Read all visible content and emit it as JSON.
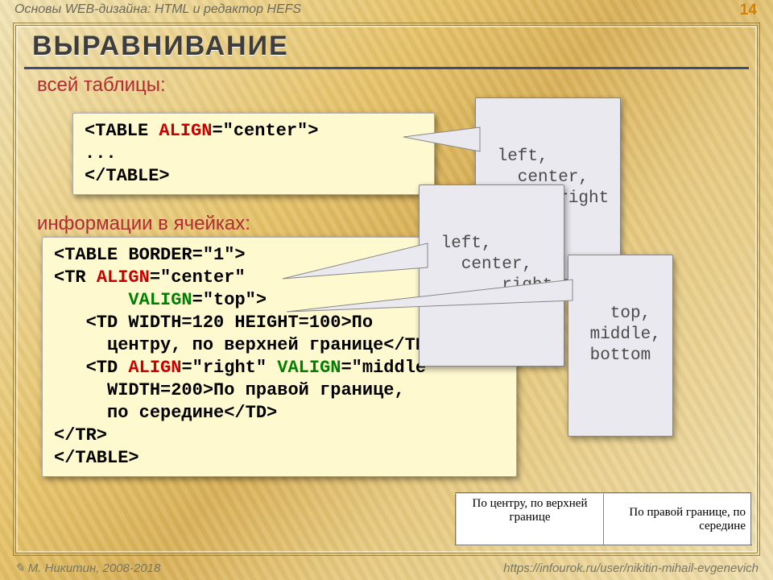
{
  "top_text": "Основы WEB-дизайна: HTML и редактор HEFS",
  "page_number": "14",
  "title": "ВЫРАВНИВАНИЕ",
  "subtitle1": "всей таблицы:",
  "subtitle2": "информации в ячейках:",
  "code1": {
    "l1_open": "<TABLE ",
    "l1_attr": "ALIGN",
    "l1_rest": "=\"center\">",
    "l2": "...",
    "l3": "</TABLE>"
  },
  "code2": {
    "l1": "<TABLE BORDER=\"1\">",
    "l2_open": "<TR ",
    "l2_attr": "ALIGN",
    "l2_rest": "=\"center\"",
    "l3_pad": "       ",
    "l3_attr": "VALIGN",
    "l3_rest": "=\"top\">",
    "l4": "   <TD WIDTH=120 HEIGHT=100>По",
    "l5": "     центру, по верхней границе</TD>",
    "l6_open": "   <TD ",
    "l6_attr1": "ALIGN",
    "l6_mid": "=\"right\" ",
    "l6_attr2": "VALIGN",
    "l6_rest": "=\"middle\"",
    "l7": "     WIDTH=200>По правой границе,",
    "l8": "     по середине</TD>",
    "l9": "</TR>",
    "l10": "</TABLE>"
  },
  "callout_align": {
    "a": " left,",
    "b": "   center,",
    "c": "       right"
  },
  "callout_valign": {
    "a": "   top,",
    "b": " middle,",
    "c": " bottom"
  },
  "preview": {
    "cell1": "По центру, по верхней границе",
    "cell2": "По правой границе, по середине"
  },
  "footer_left": "М. Никитин, 2008-2018",
  "footer_right": "https://infourok.ru/user/nikitin-mihail-evgenevich"
}
